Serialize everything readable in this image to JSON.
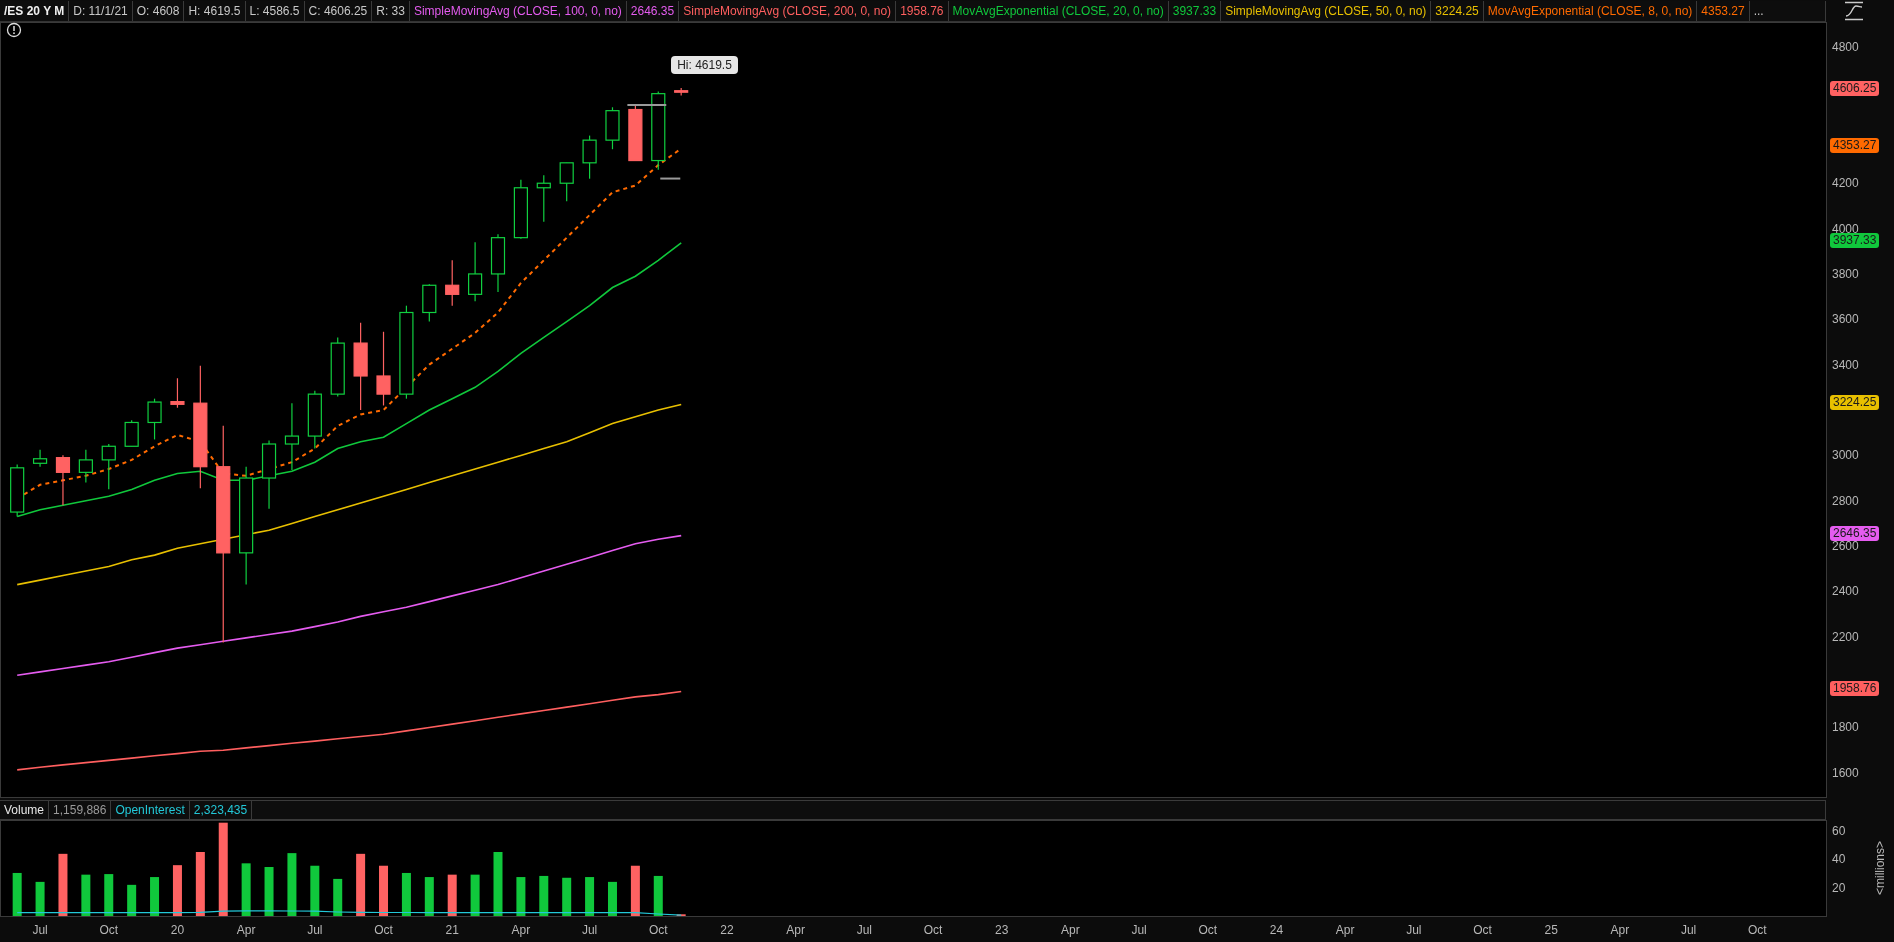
{
  "header": {
    "symbol": "/ES 20 Y M",
    "fields": [
      "D: 11/1/21",
      "O: 4608",
      "H: 4619.5",
      "L: 4586.5",
      "C: 4606.25",
      "R: 33"
    ],
    "studies": [
      {
        "name": "SimpleMovingAvg (CLOSE, 100, 0, no)",
        "value": "2646.35",
        "color": "#e55cf0"
      },
      {
        "name": "SimpleMovingAvg (CLOSE, 200, 0, no)",
        "value": "1958.76",
        "color": "#ff5f5f"
      },
      {
        "name": "MovAvgExponential (CLOSE, 20, 0, no)",
        "value": "3937.33",
        "color": "#10c83c"
      },
      {
        "name": "SimpleMovingAvg (CLOSE, 50, 0, no)",
        "value": "3224.25",
        "color": "#e8c000"
      },
      {
        "name": "MovAvgExponential (CLOSE, 8, 0, no)",
        "value": "4353.27",
        "color": "#ff6a00"
      }
    ],
    "more": "..."
  },
  "price_chart": {
    "tooltip": "Hi: 4619.5",
    "axis_labels": [
      "4800",
      "4200",
      "4000",
      "3800",
      "3600",
      "3400",
      "3000",
      "2800",
      "2600",
      "2400",
      "2200",
      "1800",
      "1600"
    ],
    "axis_tags": [
      "4606.25",
      "4353.27",
      "3937.33",
      "3224.25",
      "2646.35",
      "1958.76"
    ]
  },
  "volume_panel": {
    "readings": [
      "1,159,886",
      "2,323,435"
    ],
    "chart_data": {
      "type": "bar",
      "ylabel": "<millions>",
      "ylim": [
        0,
        67.8
      ],
      "yticks": [
        20,
        40,
        60
      ],
      "categories": [
        null,
        "Jul",
        null,
        null,
        "Oct",
        null,
        null,
        "20",
        null,
        null,
        "Apr",
        null,
        null,
        "Jul",
        null,
        null,
        "Oct",
        null,
        null,
        "21",
        null,
        null,
        "Apr",
        null,
        null,
        "Jul",
        null,
        null,
        "Oct",
        null,
        null,
        "22",
        null,
        null,
        "Apr",
        null,
        null,
        "Jul",
        null,
        null,
        "Oct",
        null,
        null,
        "23",
        null,
        null,
        "Apr",
        null,
        null,
        "Jul",
        null,
        null,
        "Oct",
        null,
        null,
        "24",
        null,
        null,
        "Apr",
        null,
        null,
        "Jul",
        null,
        null,
        "Oct",
        null,
        null,
        "25",
        null,
        null,
        "Apr",
        null,
        null,
        "Jul",
        null,
        null,
        "Oct",
        null,
        null
      ],
      "series": [
        {
          "name": "Volume",
          "colors": [
            "#10c83c",
            "#10c83c",
            "#ff6262",
            "#10c83c",
            "#10c83c",
            "#10c83c",
            "#10c83c",
            "#ff6262",
            "#ff6262",
            "#ff6262",
            "#10c83c",
            "#10c83c",
            "#10c83c",
            "#10c83c",
            "#10c83c",
            "#ff6262",
            "#ff6262",
            "#10c83c",
            "#10c83c",
            "#ff6262",
            "#10c83c",
            "#10c83c",
            "#10c83c",
            "#10c83c",
            "#10c83c",
            "#10c83c",
            "#10c83c",
            "#ff6262",
            "#10c83c",
            "#ff6262",
            null,
            null,
            null,
            null,
            null,
            null,
            null,
            null,
            null,
            null,
            null,
            null,
            null,
            null,
            null,
            null,
            null,
            null,
            null,
            null,
            null,
            null,
            null,
            null,
            null,
            null,
            null,
            null,
            null,
            null,
            null,
            null,
            null,
            null,
            null,
            null,
            null,
            null,
            null,
            null,
            null,
            null,
            null,
            null,
            null,
            null,
            null,
            null,
            null
          ],
          "values": [
            30.4,
            24.1,
            43.9,
            29.2,
            29.6,
            22,
            27.5,
            35.9,
            45.2,
            65.9,
            37.2,
            34.6,
            44.4,
            35.5,
            26.2,
            43.9,
            35.5,
            30.4,
            27.5,
            29.2,
            29.2,
            45.2,
            27.5,
            28.3,
            27,
            27.5,
            24.1,
            35.5,
            28.3,
            1.2,
            null,
            null,
            null,
            null,
            null,
            null,
            null,
            null,
            null,
            null,
            null,
            null,
            null,
            null,
            null,
            null,
            null,
            null,
            null,
            null,
            null,
            null,
            null,
            null,
            null,
            null,
            null,
            null,
            null,
            null,
            null,
            null,
            null,
            null,
            null,
            null,
            null,
            null,
            null,
            null,
            null,
            null,
            null,
            null,
            null,
            null,
            null,
            null,
            null
          ]
        },
        {
          "name": "OpenInterest",
          "type": "line",
          "color": "#22c8d8",
          "values": [
            2.4,
            2.4,
            2.4,
            2.4,
            2.4,
            2.4,
            2.4,
            2.4,
            2.6,
            3.4,
            3.6,
            3.6,
            3.5,
            3.4,
            2.8,
            2.6,
            2.5,
            2.5,
            2.4,
            2.4,
            2.4,
            2.4,
            2.4,
            2.4,
            2.4,
            2.4,
            2.4,
            2.4,
            1.4,
            0.6,
            null,
            null,
            null,
            null,
            null,
            null,
            null,
            null,
            null,
            null,
            null,
            null,
            null,
            null,
            null,
            null,
            null,
            null,
            null,
            null,
            null,
            null,
            null,
            null,
            null,
            null,
            null,
            null,
            null,
            null,
            null,
            null,
            null,
            null,
            null,
            null,
            null,
            null,
            null,
            null,
            null,
            null,
            null,
            null,
            null,
            null,
            null,
            null,
            null
          ]
        }
      ]
    }
  }
}
